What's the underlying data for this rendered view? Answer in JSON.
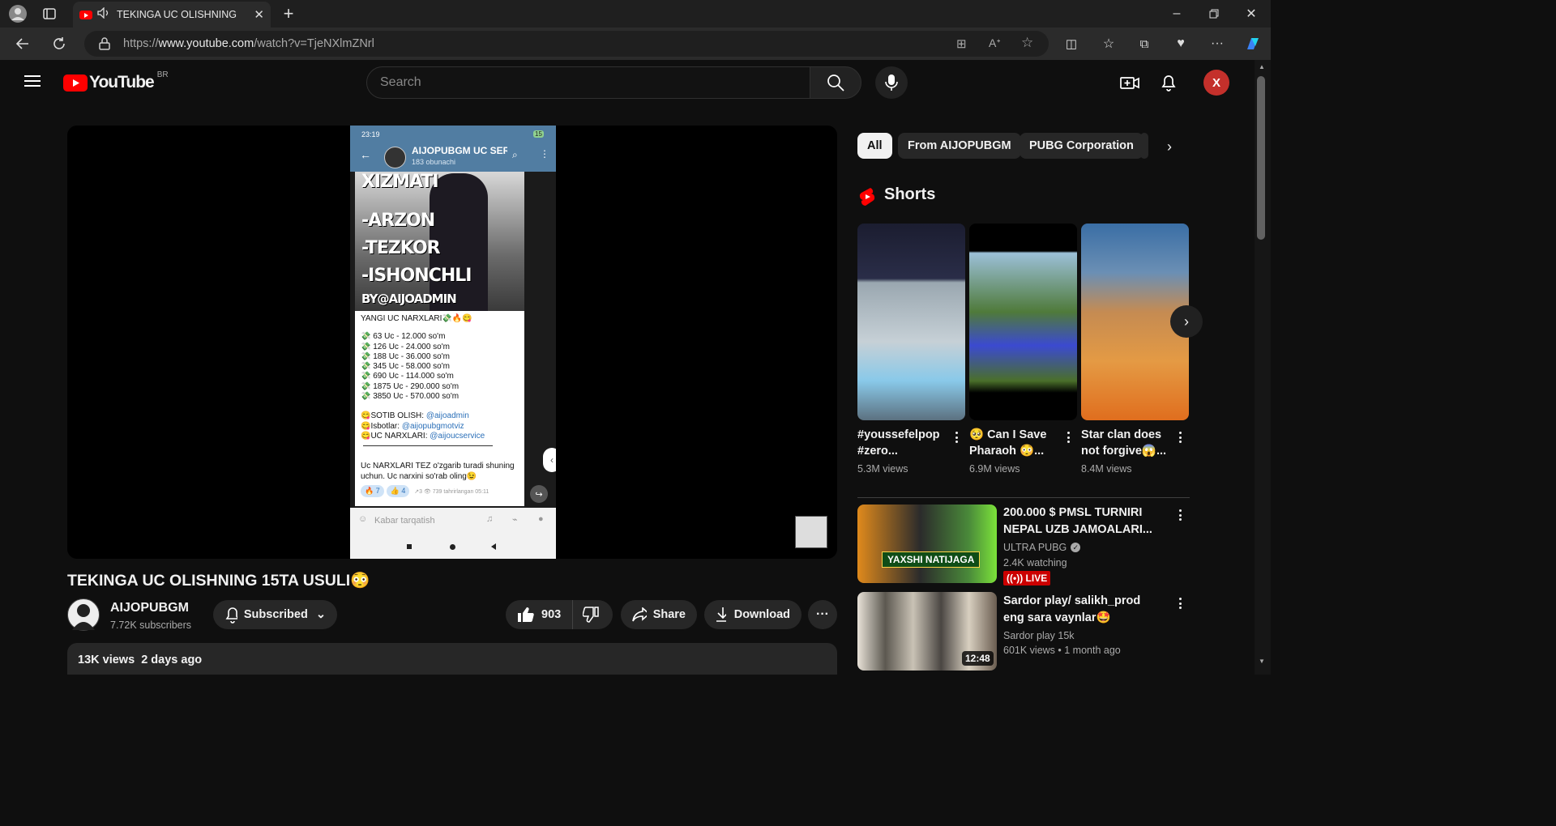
{
  "browser": {
    "tab_title": "TEKINGA UC OLISHNING 15TA USULI😳",
    "url_prefix": "https://",
    "url_domain": "www.youtube.com",
    "url_path": "/watch?v=TjeNXlmZNrl"
  },
  "header": {
    "logo_text": "YouTube",
    "region": "BR",
    "search_placeholder": "Search",
    "avatar_letter": "X"
  },
  "player": {
    "phone": {
      "status_time": "23:19",
      "battery": "15",
      "channel_name": "AIJOPUBGM UC SERVICE",
      "subscribers": "183 obunachi",
      "poster_lines": [
        "XIZMATI",
        "-ARZON",
        "-TEZKOR",
        "-ISHONCHLI",
        "BY@AIJOADMIN"
      ],
      "prices_heading": "YANGI UC NARXLARI💸🔥😋",
      "prices": [
        "💸 63 Uc - 12.000 so'm",
        "💸 126 Uc - 24.000 so'm",
        "💸 188 Uc - 36.000 so'm",
        "💸 345 Uc - 58.000 so'm",
        "💸 690 Uc - 114.000 so'm",
        "💸 1875 Uc - 290.000 so'm",
        "💸 3850 Uc - 570.000 so'm"
      ],
      "links": [
        {
          "label": "😋SOTIB OLISH: ",
          "handle": "@aijoadmin"
        },
        {
          "label": "😋Isbotlar: ",
          "handle": "@aijopubgmotviz"
        },
        {
          "label": "😋UC NARXLARI: ",
          "handle": "@aijoucservice"
        }
      ],
      "footer_text": "Uc NARXLARI TEZ o'zgarib turadi shuning uchun. Uc narxini so'rab oling😉",
      "reaction_fire": "🔥 7",
      "reaction_like": "👍 4",
      "post_meta": "↗3 👁 739 tahrirlangan 05:11",
      "input_placeholder": "Kabar tarqatish"
    }
  },
  "video": {
    "title": "TEKINGA UC OLISHNING 15TA USULI😳",
    "channel": "AIJOPUBGM",
    "subscribers": "7.72K subscribers",
    "subscribed_label": "Subscribed",
    "likes": "903",
    "share_label": "Share",
    "download_label": "Download",
    "views": "13K views",
    "age": "2 days ago"
  },
  "chips": [
    "All",
    "From AIJOPUBGM",
    "PUBG Corporation"
  ],
  "shorts": {
    "heading": "Shorts",
    "items": [
      {
        "title": "#youssefelpop #zero...",
        "views": "5.3M views"
      },
      {
        "title": "🥺 Can I Save Pharaoh 😳...",
        "views": "6.9M views"
      },
      {
        "title": "Star clan does not forgive😱...",
        "views": "8.4M views"
      }
    ]
  },
  "recommendations": [
    {
      "title": "200.000 $ PMSL TURNIRI NEPAL UZB JAMOALARI...",
      "channel": "ULTRA PUBG",
      "meta": "2.4K watching",
      "badge": "LIVE",
      "thumb_text": "YAXSHI NATIJAGA"
    },
    {
      "title": "Sardor play/ salikh_prod eng sara vaynlar🤩",
      "channel": "Sardor play 15k",
      "meta": "601K views • 1 month ago",
      "duration": "12:48"
    }
  ],
  "colors": {
    "accent_red": "#ff0000",
    "live_red": "#cc0000",
    "link_blue": "#3ea6ff",
    "telegram_blue": "#517da2"
  }
}
